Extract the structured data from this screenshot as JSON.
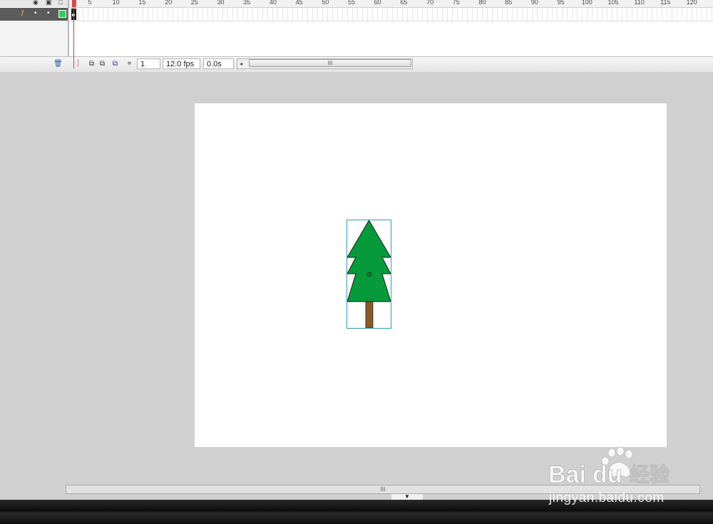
{
  "timeline": {
    "ruler_ticks": [
      "5",
      "10",
      "15",
      "20",
      "25",
      "30",
      "35",
      "40",
      "45",
      "50",
      "55",
      "60",
      "65",
      "70",
      "75",
      "80",
      "85",
      "90",
      "95",
      "100",
      "105",
      "110",
      "115",
      "120"
    ],
    "current_frame": "1",
    "frame_rate": "12.0 fps",
    "elapsed_time": "0.0s",
    "scroll_grip": "III"
  },
  "stage": {
    "background": "#ffffff",
    "tree_color": "#079a3b",
    "trunk_color": "#8b5a2b"
  },
  "bottom": {
    "scroll_grip": "III",
    "collapse_arrow": "▼"
  },
  "watermark": {
    "text": "jingyan.baidu.com"
  }
}
